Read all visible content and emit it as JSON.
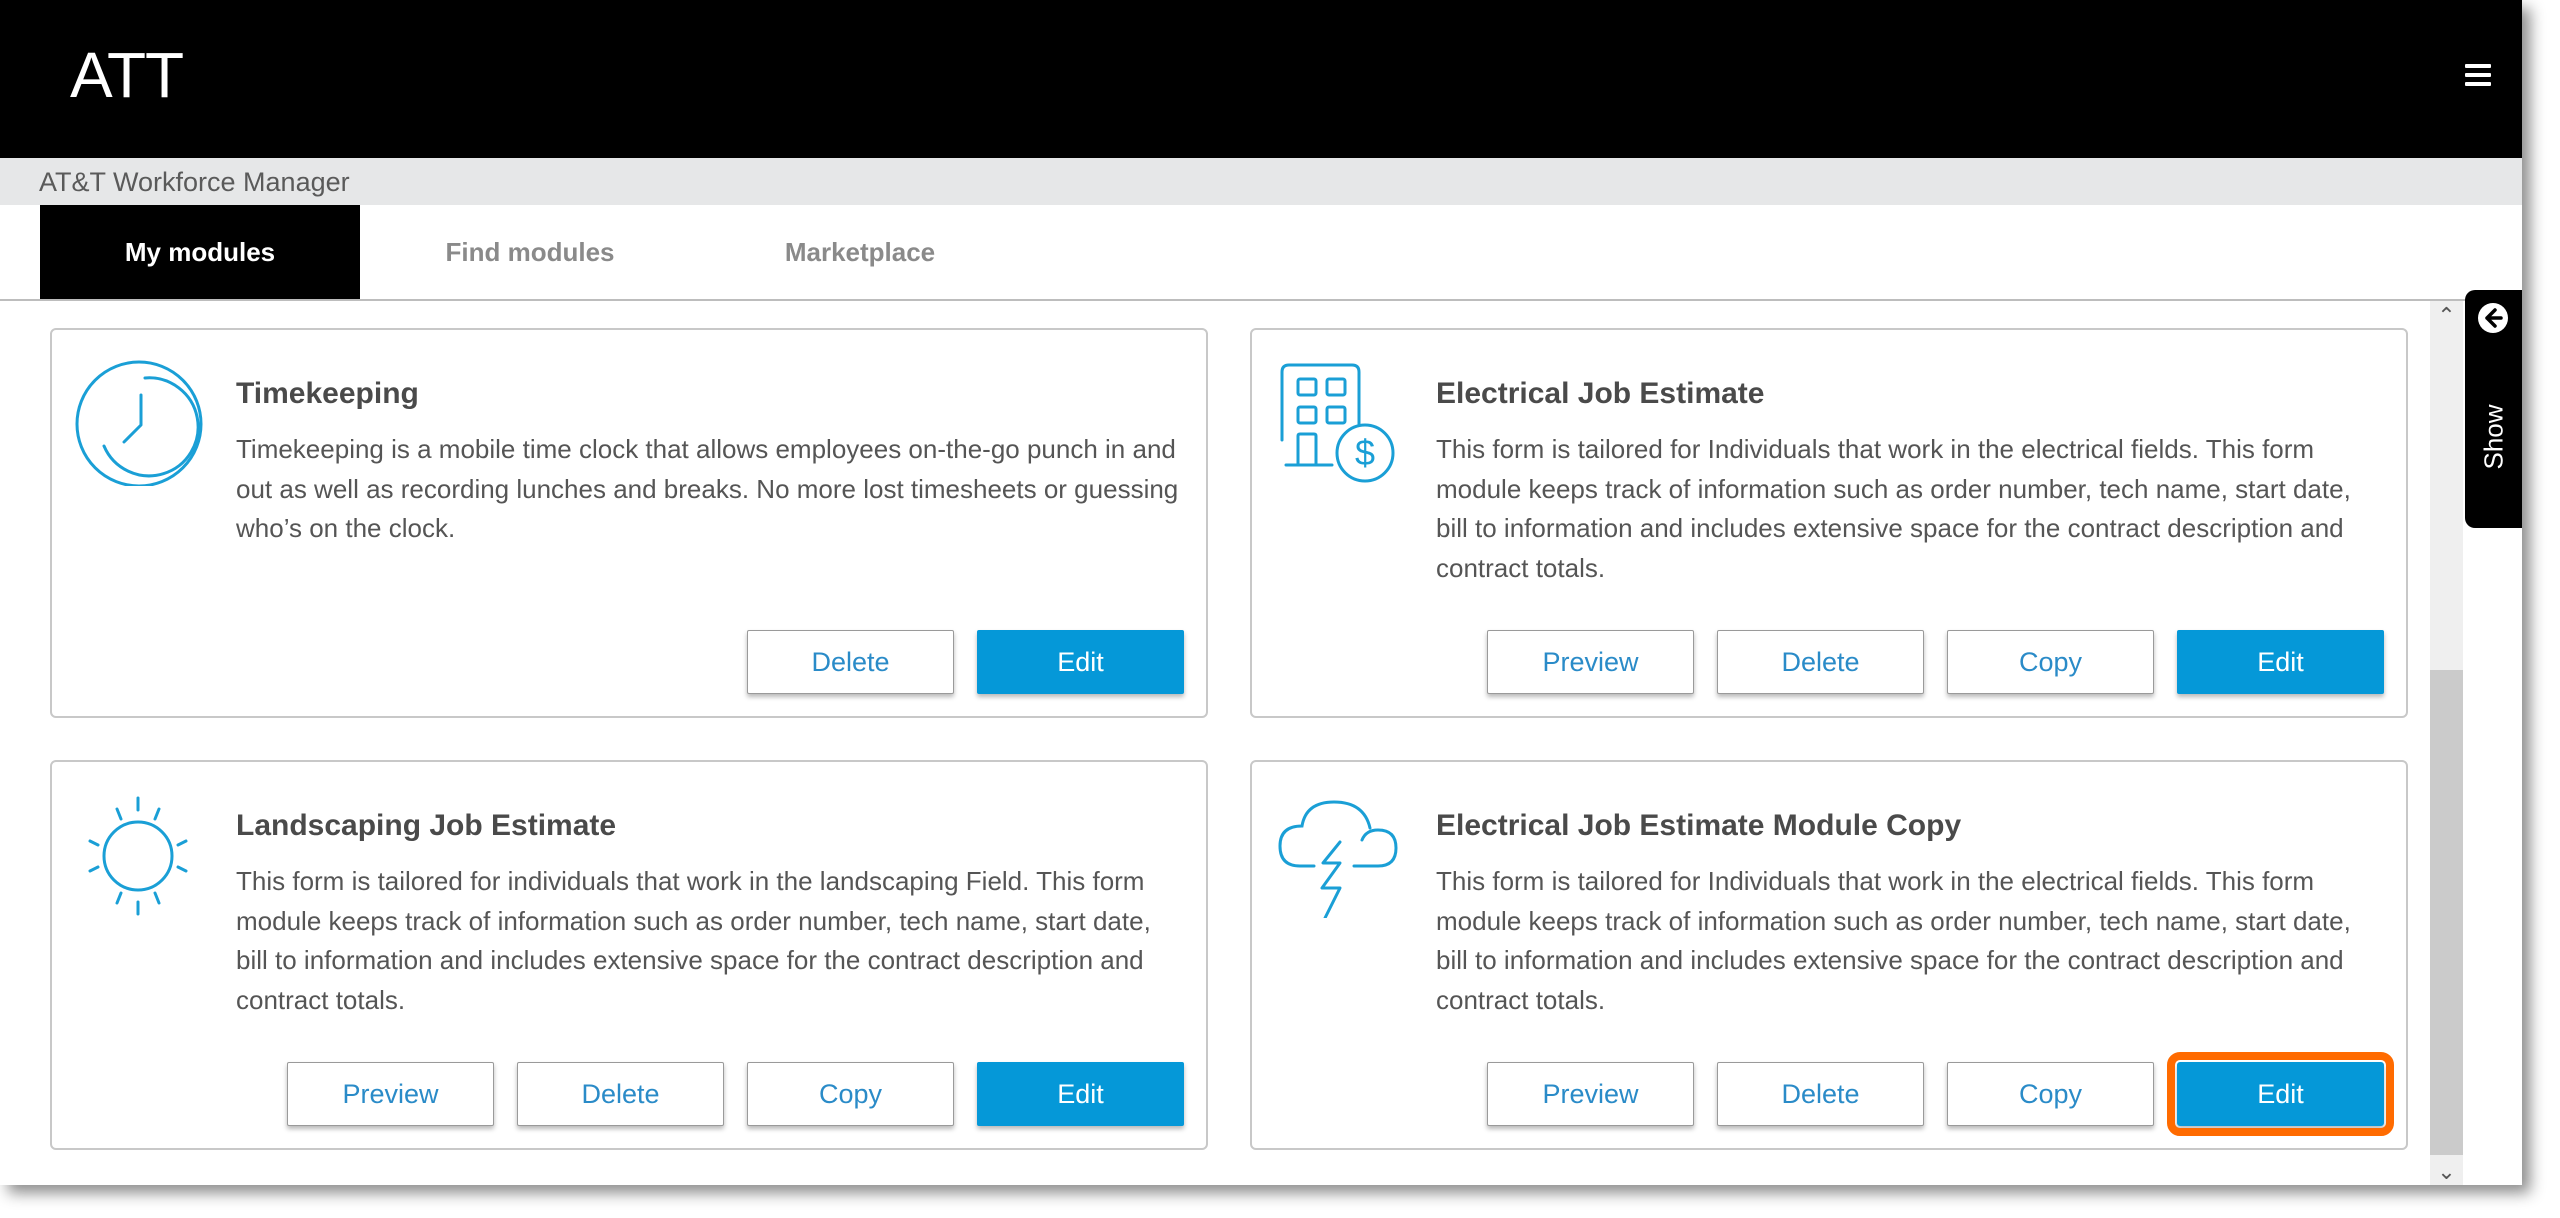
{
  "header": {
    "logo": "ATT",
    "menu_icon": "hamburger-menu-icon"
  },
  "subheader": {
    "title": "AT&T Workforce Manager"
  },
  "tabs": [
    {
      "label": "My modules",
      "active": true
    },
    {
      "label": "Find modules",
      "active": false
    },
    {
      "label": "Marketplace",
      "active": false
    }
  ],
  "side_panel": {
    "label": "Show",
    "icon": "arrow-left-circle-icon"
  },
  "colors": {
    "accent": "#0598d8",
    "icon_blue": "#1a9fd6",
    "highlight": "#ff6b00",
    "header_bg": "#000000"
  },
  "modules": [
    {
      "title": "Timekeeping",
      "icon": "clock-icon",
      "description": "Timekeeping is a mobile time clock that allows employees on-the-go punch in and out as well as recording lunches and breaks. No more lost timesheets or guessing who’s on the clock.",
      "buttons": [
        "Delete",
        "Edit"
      ]
    },
    {
      "title": "Electrical Job Estimate",
      "icon": "building-dollar-icon",
      "description": "This form is tailored for Individuals that work in the electrical fields. This form module keeps track of information such as order number, tech name, start date, bill to information and includes extensive space for the contract description and contract totals.",
      "buttons": [
        "Preview",
        "Delete",
        "Copy",
        "Edit"
      ]
    },
    {
      "title": "Landscaping Job Estimate",
      "icon": "sun-icon",
      "description": "This form is tailored for individuals that work in the landscaping Field. This form module keeps track of information such as order number, tech name, start date, bill to information and includes extensive space for the contract description and contract totals.",
      "buttons": [
        "Preview",
        "Delete",
        "Copy",
        "Edit"
      ]
    },
    {
      "title": "Electrical Job Estimate Module Copy",
      "icon": "cloud-lightning-icon",
      "description": "This form is tailored for Individuals that work in the electrical fields. This form module keeps track of information such as order number, tech name, start date, bill to information and includes extensive space for the contract description and contract totals.",
      "buttons": [
        "Preview",
        "Delete",
        "Copy",
        "Edit"
      ],
      "highlighted_button": "Edit"
    }
  ]
}
